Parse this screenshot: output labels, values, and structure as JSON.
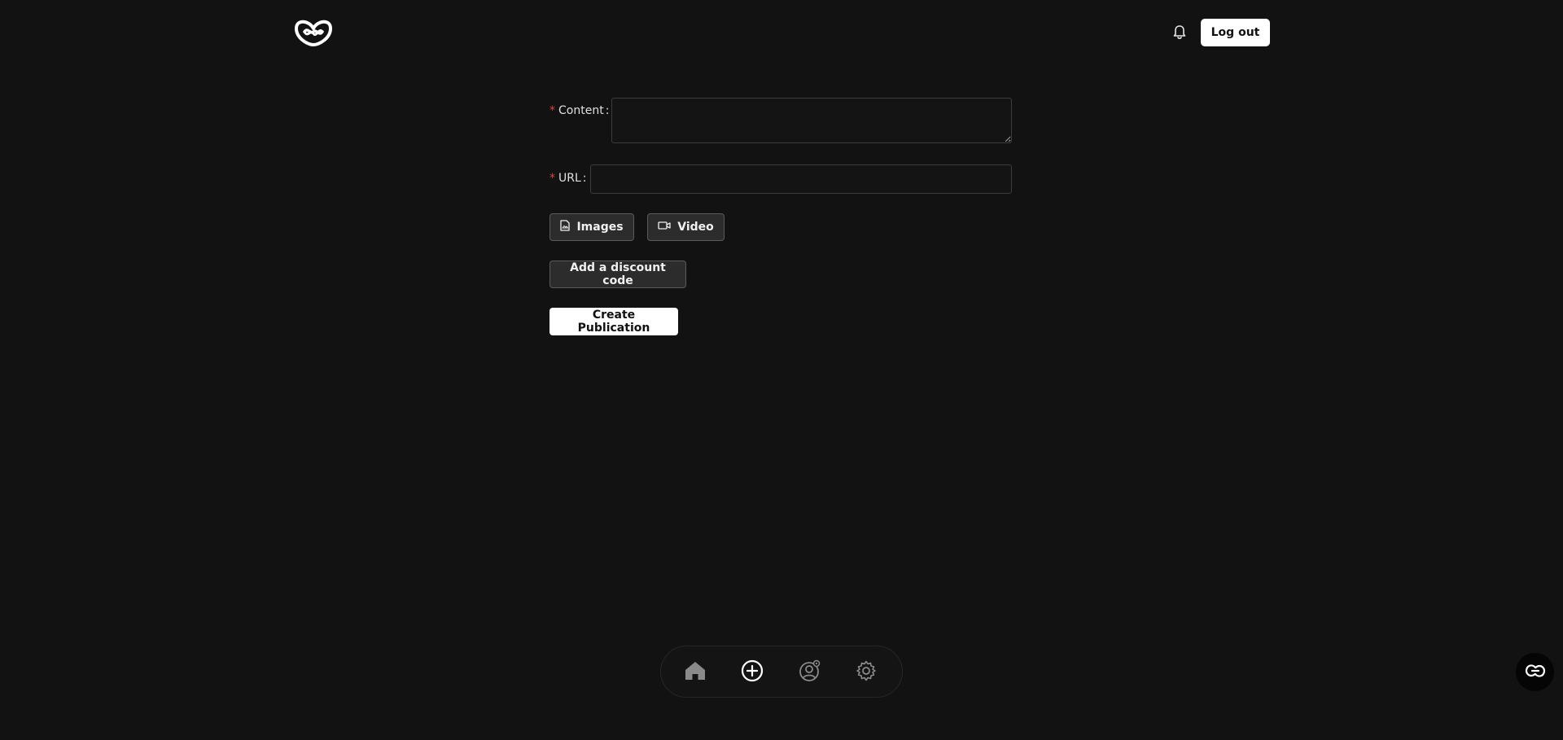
{
  "header": {
    "logo_icon": "heart-knot-logo",
    "notification_icon": "bell-icon",
    "logout_label": "Log out"
  },
  "form": {
    "content": {
      "required_mark": "*",
      "label": "Content",
      "value": "",
      "placeholder": ""
    },
    "url": {
      "required_mark": "*",
      "label": "URL",
      "value": "",
      "placeholder": ""
    },
    "media_buttons": {
      "images_label": "Images",
      "images_icon": "file-image-icon",
      "video_label": "Video",
      "video_icon": "video-icon"
    },
    "discount_label": "Add a discount code",
    "submit_label": "Create Publication"
  },
  "bottom_nav": {
    "items": [
      {
        "name": "home",
        "icon": "home-icon",
        "active": false
      },
      {
        "name": "create",
        "icon": "plus-circle-icon",
        "active": true
      },
      {
        "name": "profile",
        "icon": "user-settings-icon",
        "active": false
      },
      {
        "name": "settings",
        "icon": "gear-icon",
        "active": false
      }
    ]
  },
  "floating_button": {
    "icon": "chat-link-icon"
  },
  "colors": {
    "background": "#121212",
    "required": "#d64545",
    "button_light": "#ffffff",
    "button_dark": "#2c2c2c"
  }
}
